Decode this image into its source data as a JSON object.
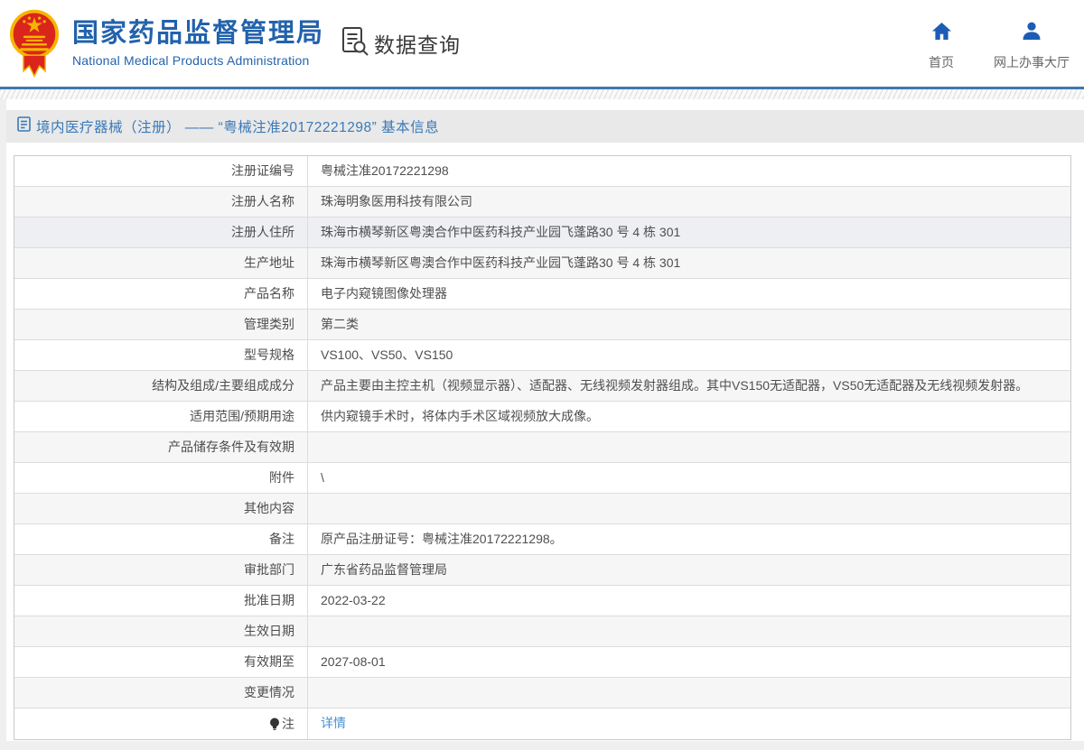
{
  "header": {
    "logo": {
      "title": "国家药品监督管理局",
      "subtitle": "National Medical Products Administration",
      "emblem_icon": "china-national-emblem"
    },
    "section_label": "数据查询",
    "section_icon": "document-search-icon",
    "nav": [
      {
        "label": "首页",
        "icon": "home-icon"
      },
      {
        "label": "网上办事大厅",
        "icon": "user-icon"
      }
    ]
  },
  "breadcrumb": {
    "icon": "document-icon",
    "title": "境内医疗器械（注册） —— “粤械注准20172221298” 基本信息"
  },
  "table": {
    "rows": [
      {
        "label": "注册证编号",
        "value": "粤械注准20172221298"
      },
      {
        "label": "注册人名称",
        "value": "珠海明象医用科技有限公司"
      },
      {
        "label": "注册人住所",
        "value": "珠海市横琴新区粤澳合作中医药科技产业园飞蓬路30 号 4 栋 301",
        "highlight": true
      },
      {
        "label": "生产地址",
        "value": "珠海市横琴新区粤澳合作中医药科技产业园飞蓬路30 号 4 栋 301"
      },
      {
        "label": "产品名称",
        "value": "电子内窥镜图像处理器"
      },
      {
        "label": "管理类别",
        "value": "第二类"
      },
      {
        "label": "型号规格",
        "value": "VS100、VS50、VS150"
      },
      {
        "label": "结构及组成/主要组成成分",
        "value": "产品主要由主控主机（视频显示器）、适配器、无线视频发射器组成。其中VS150无适配器，VS50无适配器及无线视频发射器。"
      },
      {
        "label": "适用范围/预期用途",
        "value": "供内窥镜手术时，将体内手术区域视频放大成像。"
      },
      {
        "label": "产品储存条件及有效期",
        "value": ""
      },
      {
        "label": "附件",
        "value": "\\"
      },
      {
        "label": "其他内容",
        "value": ""
      },
      {
        "label": "备注",
        "value": "原产品注册证号：粤械注准20172221298。"
      },
      {
        "label": "审批部门",
        "value": "广东省药品监督管理局"
      },
      {
        "label": "批准日期",
        "value": "2022-03-22"
      },
      {
        "label": "生效日期",
        "value": ""
      },
      {
        "label": "有效期至",
        "value": "2027-08-01"
      },
      {
        "label": "变更情况",
        "value": ""
      },
      {
        "label": "注",
        "label_icon": "bulb-icon",
        "value": "详情",
        "link": true
      }
    ]
  },
  "colors": {
    "accent_blue": "#2262ac",
    "nav_icon_blue": "#1d5cb5",
    "link_blue": "#4a90d2",
    "breadcrumb_blue": "#3a79b8",
    "divider_blue": "#4077ad",
    "emblem_red": "#da251c",
    "emblem_gold": "#f7b500",
    "row_alt_bg": "#f6f6f6",
    "row_hover_bg": "#edeff3"
  }
}
